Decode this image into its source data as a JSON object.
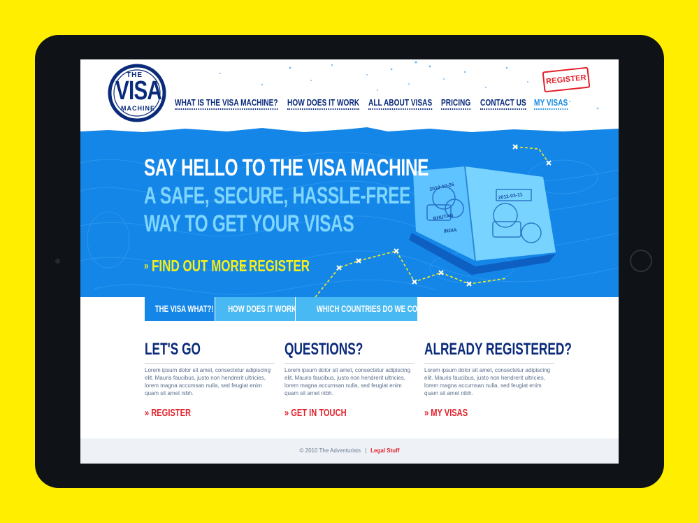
{
  "logo": {
    "top": "THE",
    "main": "VISA",
    "bottom": "MACHINE"
  },
  "nav": {
    "items": [
      {
        "label": "WHAT IS THE VISA MACHINE?"
      },
      {
        "label": "HOW DOES IT WORK"
      },
      {
        "label": "ALL ABOUT VISAS"
      },
      {
        "label": "PRICING"
      },
      {
        "label": "CONTACT US"
      },
      {
        "label": "MY VISAS"
      }
    ],
    "register_label": "REGISTER"
  },
  "hero": {
    "line1": "SAY HELLO TO THE VISA MACHINE",
    "line2": "A SAFE, SECURE, HASSLE-FREE",
    "line3": "WAY TO GET YOUR VISAS",
    "cta_find_out": "FIND OUT MORE",
    "cta_register": "REGISTER",
    "cta_arrow": "»"
  },
  "tabs": [
    {
      "label": "THE VISA WHAT?!"
    },
    {
      "label": "HOW DOES IT WORK?"
    },
    {
      "label": "WHICH COUNTRIES DO WE COVER?"
    }
  ],
  "columns": [
    {
      "title": "LET'S GO",
      "body": "Lorem ipsum dolor sit amet, consectetur adipiscing elit. Mauris faucibus, justo non hendrerit ultricies, lorem magna accumsan nulla, sed feugiat enim quam sit amet nibh.",
      "link": "REGISTER"
    },
    {
      "title": "QUESTIONS?",
      "body": "Lorem ipsum dolor sit amet, consectetur adipiscing elit. Mauris faucibus, justo non hendrerit ultricies, lorem magna accumsan nulla, sed feugiat enim quam sit amet nibh.",
      "link": "GET IN TOUCH"
    },
    {
      "title": "ALREADY REGISTERED?",
      "body": "Lorem ipsum dolor sit amet, consectetur adipiscing elit. Mauris faucibus, justo non hendrerit ultricies, lorem magna accumsan nulla, sed feugiat enim quam sit amet nibh.",
      "link": "MY VISAS"
    }
  ],
  "link_arrow": "»",
  "footer": {
    "copyright": "© 2010 The Adventurists",
    "separator": "|",
    "legal": "Legal Stuff"
  },
  "passport": {
    "stamps": [
      "2012-10-26",
      "2011-03-11",
      "BHUTAN",
      "INDIA"
    ]
  },
  "colors": {
    "background": "#ffee00",
    "hero": "#1486e8",
    "navy": "#0a2a7a",
    "accent_red": "#e2202a",
    "cta_yellow": "#f5ee1a",
    "light_blue": "#7fd6ff"
  }
}
